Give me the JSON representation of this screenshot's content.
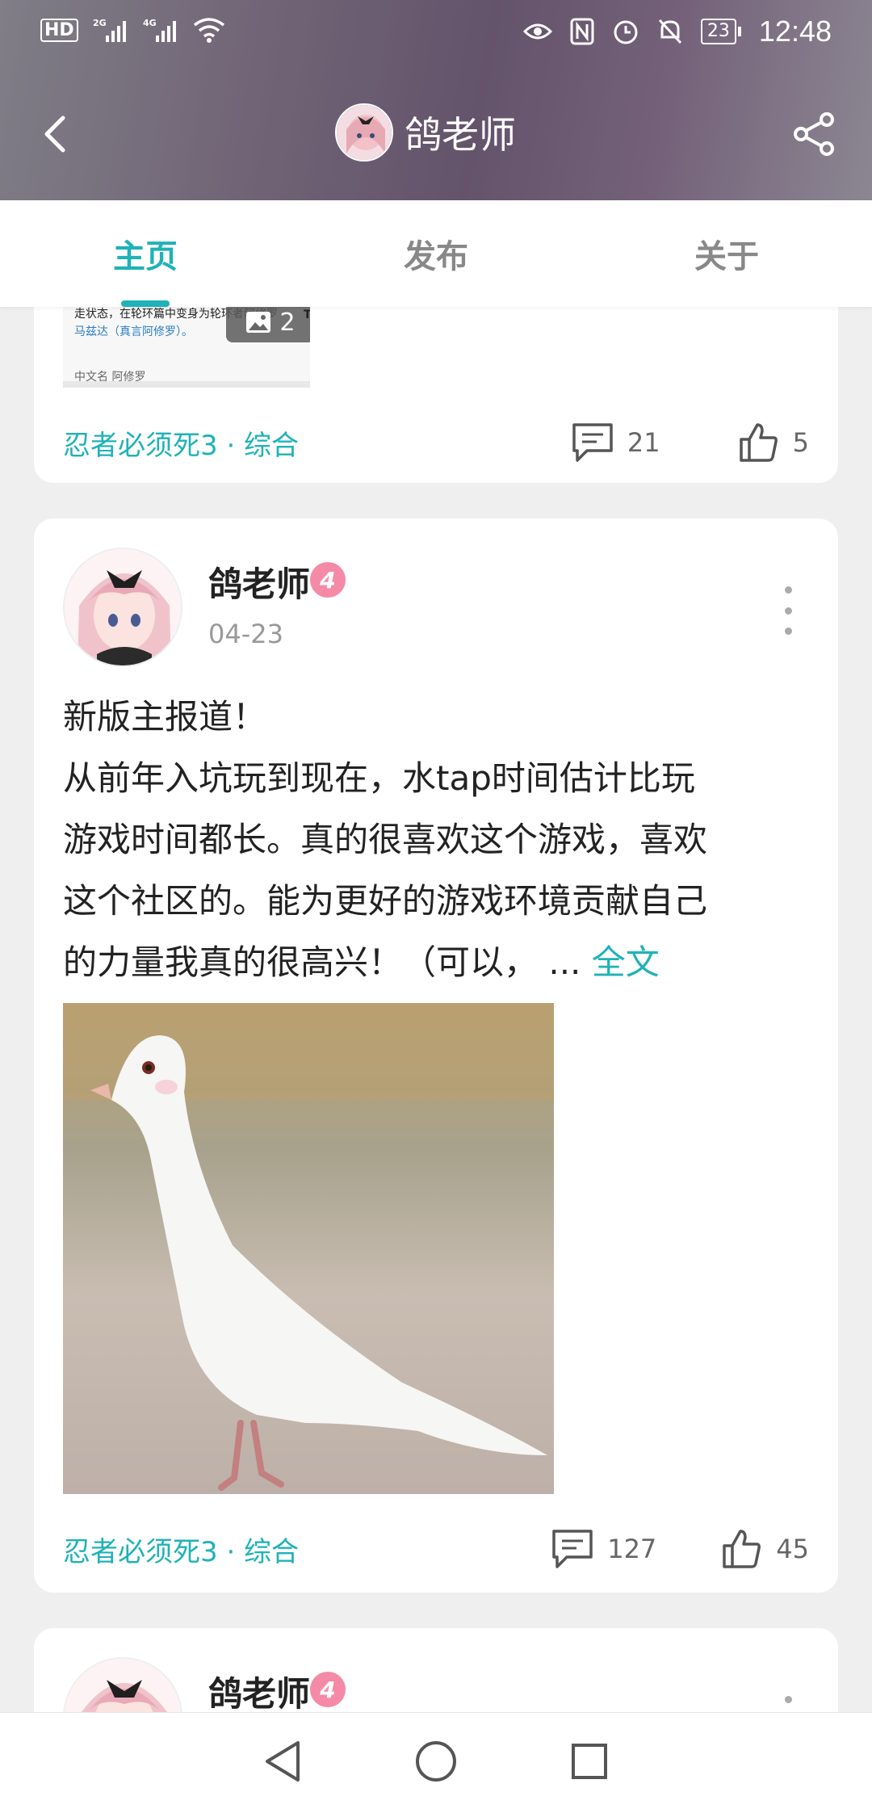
{
  "status_bar": {
    "left_icons": [
      "hd-icon",
      "signal-2g-icon",
      "signal-4g-icon",
      "wifi-icon"
    ],
    "right_icons": [
      "eye-icon",
      "nfc-icon",
      "alarm-icon",
      "mute-icon",
      "battery-icon"
    ],
    "battery": "23",
    "time": "12:48"
  },
  "header": {
    "title": "鸽老师",
    "back_icon": "back-icon",
    "share_icon": "share-icon"
  },
  "tabs": [
    {
      "label": "主页",
      "active": true
    },
    {
      "label": "发布",
      "active": false
    },
    {
      "label": "关于",
      "active": false
    }
  ],
  "posts": [
    {
      "thumbnail_lines": [
        "走状态，在轮环篇中变身为轮环者阿修罗",
        "马兹达（真言阿修罗）。",
        "中文名    阿修罗"
      ],
      "thumbnail_corner": "TA",
      "image_count": "2",
      "topic": "忍者必须死3 · 综合",
      "comments": "21",
      "likes": "5"
    },
    {
      "author": "鸽老师",
      "level": "4",
      "date": "04-23",
      "text_lines": [
        "新版主报道！",
        "从前年入坑玩到现在，水tap时间估计比玩",
        "游戏时间都长。真的很喜欢这个游戏，喜欢",
        "这个社区的。能为更好的游戏环境贡献自己",
        "的力量我真的很高兴！（可以，  ... "
      ],
      "more_label": "全文",
      "topic": "忍者必须死3 · 综合",
      "comments": "127",
      "likes": "45"
    },
    {
      "author": "鸽老师",
      "level": "4"
    }
  ],
  "system_nav": [
    "back-triangle-icon",
    "home-circle-icon",
    "recents-square-icon"
  ],
  "colors": {
    "accent": "#1fb2b7",
    "level_badge": "#f48aa6"
  }
}
